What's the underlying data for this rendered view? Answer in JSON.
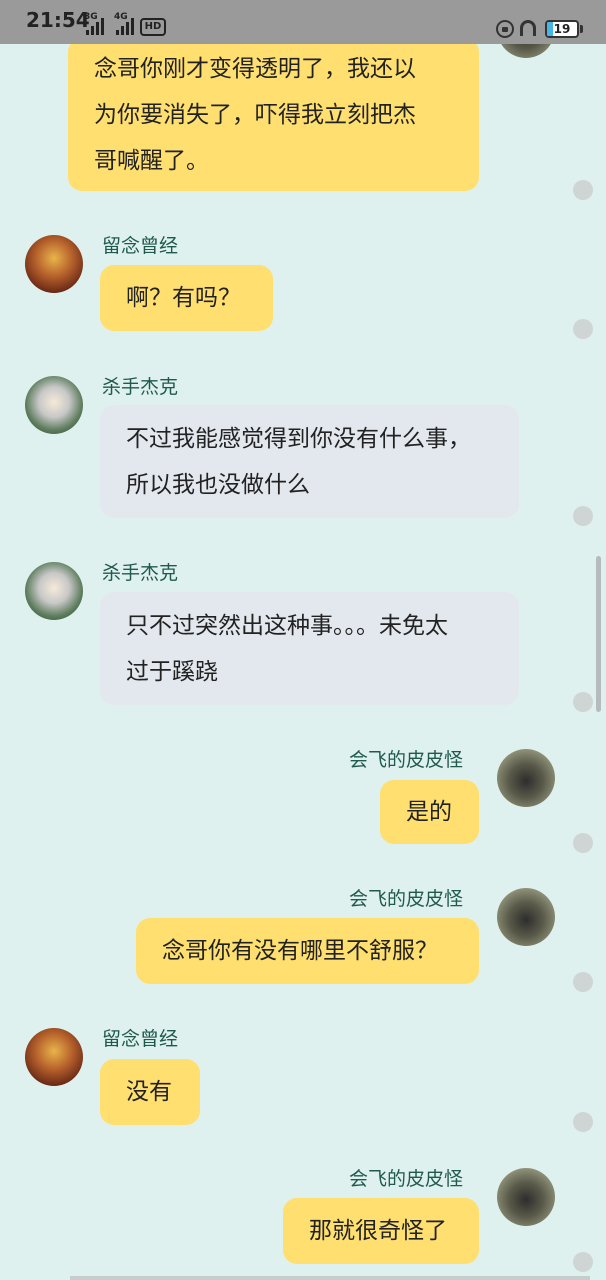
{
  "status_bar": {
    "time": "21:54",
    "net1": "3G",
    "net2": "4G",
    "hd": "HD",
    "battery": "19",
    "battery_level": 0.19
  },
  "messages": [
    {
      "side": "right",
      "lines": [
        "念哥你刚才变得透明了，我还以",
        "为你要消失了，吓得我立刻把杰",
        "哥喊醒了。"
      ]
    },
    {
      "side": "left",
      "sender": "留念曾经",
      "avatar": "red",
      "lines": [
        "啊？有吗？"
      ]
    },
    {
      "side": "left",
      "sender": "杀手杰克",
      "avatar": "green",
      "lines": [
        "不过我能感觉得到你没有什么事，",
        "所以我也没做什么"
      ]
    },
    {
      "side": "left",
      "sender": "杀手杰克",
      "avatar": "green",
      "lines": [
        "只不过突然出这种事。。。未免太",
        "过于蹊跷"
      ]
    },
    {
      "side": "right",
      "sender": "会飞的皮皮怪",
      "avatar": "grey",
      "lines": [
        "是的"
      ]
    },
    {
      "side": "right",
      "sender": "会飞的皮皮怪",
      "avatar": "grey",
      "lines": [
        "念哥你有没有哪里不舒服？"
      ]
    },
    {
      "side": "left",
      "sender": "留念曾经",
      "avatar": "red",
      "lines": [
        "没有"
      ]
    },
    {
      "side": "right",
      "sender": "会飞的皮皮怪",
      "avatar": "grey",
      "lines": [
        "那就很奇怪了"
      ]
    }
  ]
}
